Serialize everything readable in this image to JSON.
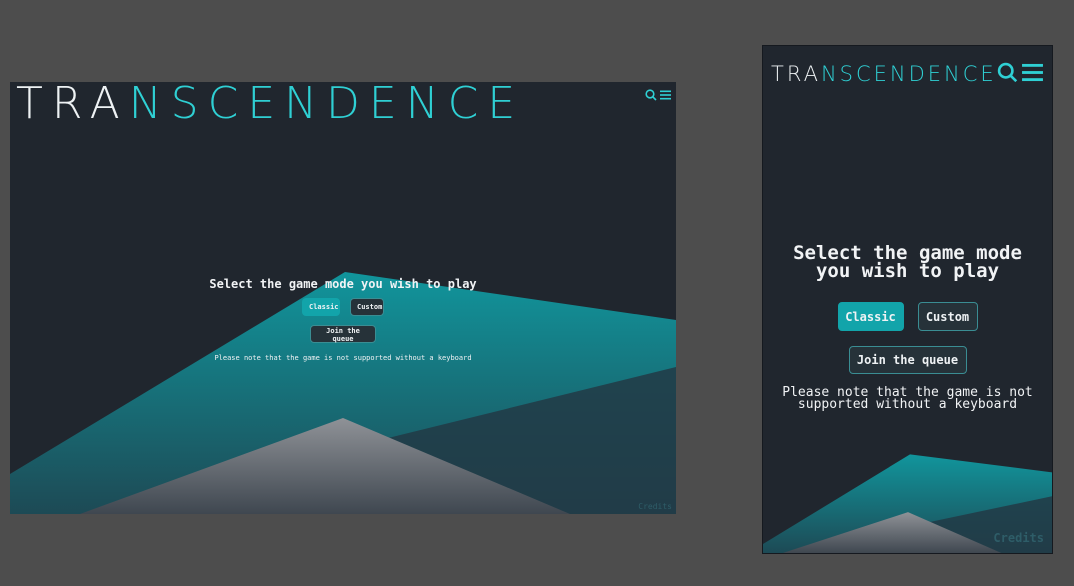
{
  "app": {
    "logo_prefix": "TRA",
    "logo_suffix": "NSCENDENCE",
    "accent_color": "#2fd0d4",
    "background_color": "#20262e"
  },
  "header": {
    "search_icon": "search-icon",
    "menu_icon": "hamburger-menu-icon"
  },
  "desktop": {
    "title": "Select the game mode you wish to play",
    "classic_label": "Classic",
    "custom_label": "Custom",
    "queue_label": "Join the queue",
    "note": "Please note that the game is not supported without a keyboard",
    "credits": "Credits"
  },
  "mobile": {
    "title": "Select the game mode you wish to play",
    "classic_label": "Classic",
    "custom_label": "Custom",
    "queue_label": "Join the queue",
    "note": "Please note that the game is not supported without a keyboard",
    "credits": "Credits"
  }
}
